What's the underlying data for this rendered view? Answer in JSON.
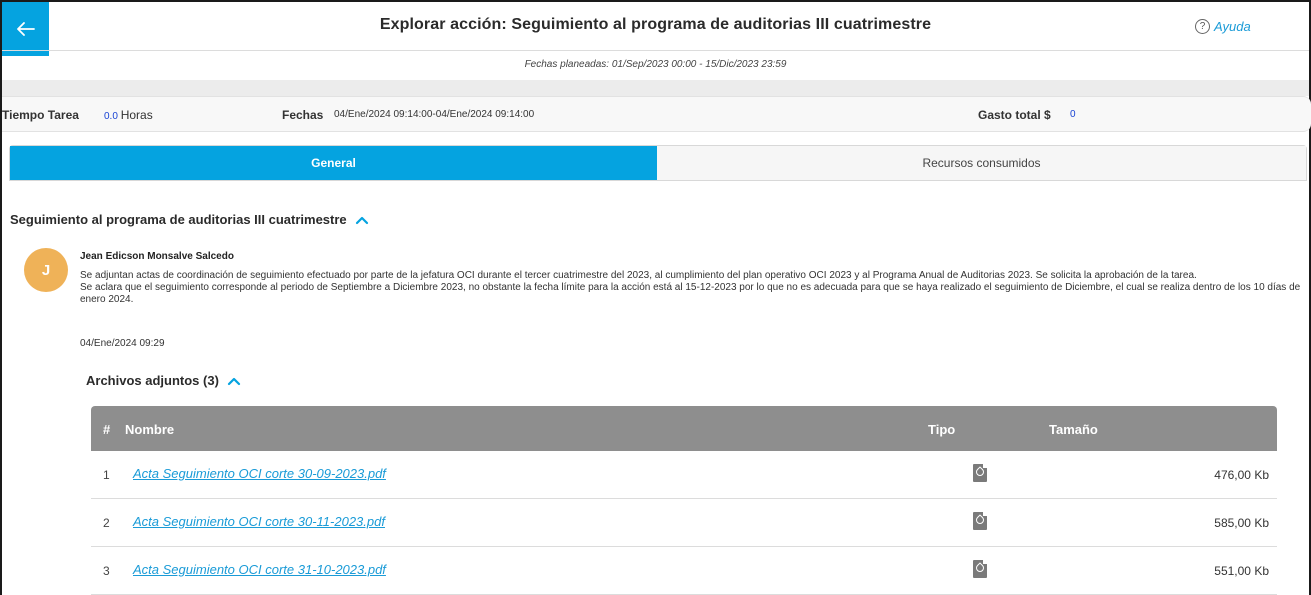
{
  "header": {
    "title": "Explorar acción: Seguimiento al programa de auditorias III cuatrimestre",
    "help_label": "Ayuda",
    "planned_dates": "Fechas planeadas: 01/Sep/2023 00:00 - 15/Dic/2023 23:59"
  },
  "info": {
    "tiempo_label": "Tiempo Tarea",
    "tiempo_value": "0.0",
    "tiempo_unit": "Horas",
    "fechas_label": "Fechas",
    "fechas_value": "04/Ene/2024 09:14:00-04/Ene/2024 09:14:00",
    "gasto_label": "Gasto total $",
    "gasto_value": "0"
  },
  "tabs": [
    {
      "label": "General",
      "active": true
    },
    {
      "label": "Recursos consumidos",
      "active": false
    }
  ],
  "section": {
    "title": "Seguimiento al programa de auditorias III cuatrimestre",
    "author_initial": "J",
    "author_name": "Jean Edicson Monsalve Salcedo",
    "comment_line1": "Se adjuntan actas de coordinación de seguimiento efectuado por parte de la jefatura OCI durante el tercer cuatrimestre del 2023, al cumplimiento del plan operativo OCI 2023 y al Programa Anual de Auditorias 2023. Se solicita la aprobación de la tarea.",
    "comment_line2": "Se aclara que el seguimiento corresponde al periodo de Septiembre a Diciembre 2023, no obstante la fecha límite para la acción está al 15-12-2023 por lo que no es adecuada para que se haya realizado el seguimiento de Diciembre, el cual se realiza dentro de los 10 días de enero 2024.",
    "date": "04/Ene/2024 09:29",
    "attachments_title": "Archivos adjuntos (3)"
  },
  "table": {
    "columns": [
      "#",
      "Nombre",
      "Tipo",
      "Tamaño"
    ],
    "rows": [
      {
        "idx": "1",
        "name": "Acta Seguimiento OCI corte 30-09-2023.pdf",
        "size": "476,00 Kb"
      },
      {
        "idx": "2",
        "name": "Acta Seguimiento OCI corte 30-11-2023.pdf",
        "size": "585,00 Kb"
      },
      {
        "idx": "3",
        "name": "Acta Seguimiento OCI corte 31-10-2023.pdf",
        "size": "551,00 Kb"
      }
    ]
  },
  "colors": {
    "accent": "#05a3e0",
    "link": "#1a9bd7",
    "avatar": "#efb258",
    "table_header": "#8e8e8e"
  },
  "icons": {
    "back": "arrow-left-icon",
    "help": "question-circle-icon",
    "collapse": "chevron-up-icon",
    "file_type": "pdf-file-icon"
  }
}
